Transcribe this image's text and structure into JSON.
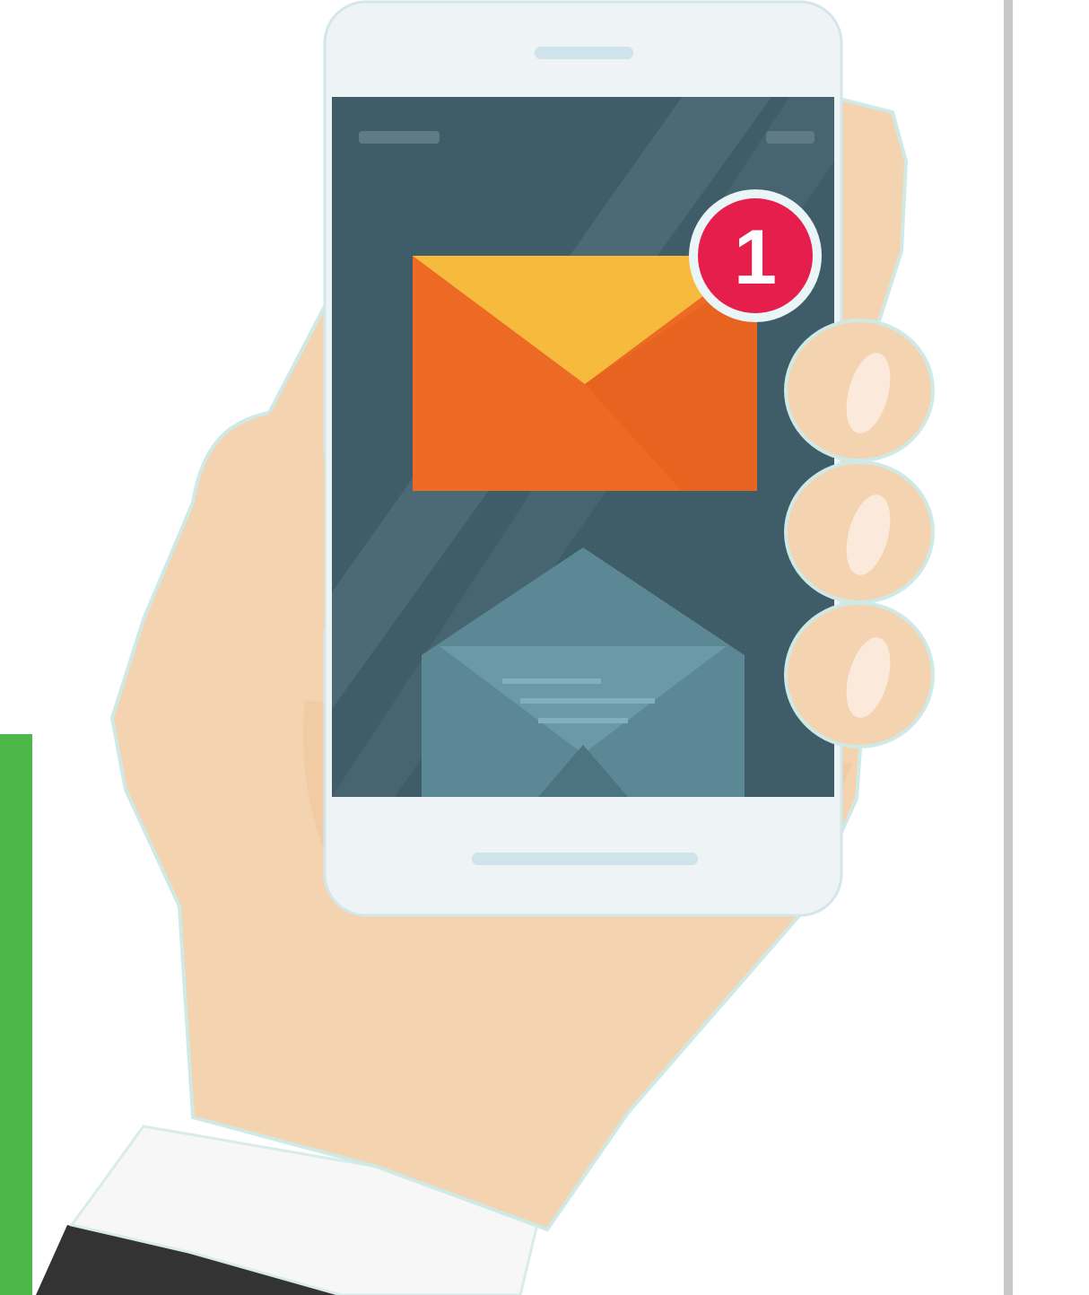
{
  "notification": {
    "count": "1"
  },
  "colors": {
    "accent_green": "#4db848",
    "screen_bg": "#3f5d68",
    "envelope_orange": "#ec6a23",
    "envelope_flap": "#f6bb3d",
    "badge_red": "#e61e4b",
    "skin": "#f4d3b0",
    "phone_body": "#eef4f6",
    "divider_gray": "#c8c8c8"
  },
  "icons": {
    "main": "mail-notification-icon",
    "background_envelope": "envelope-icon"
  }
}
